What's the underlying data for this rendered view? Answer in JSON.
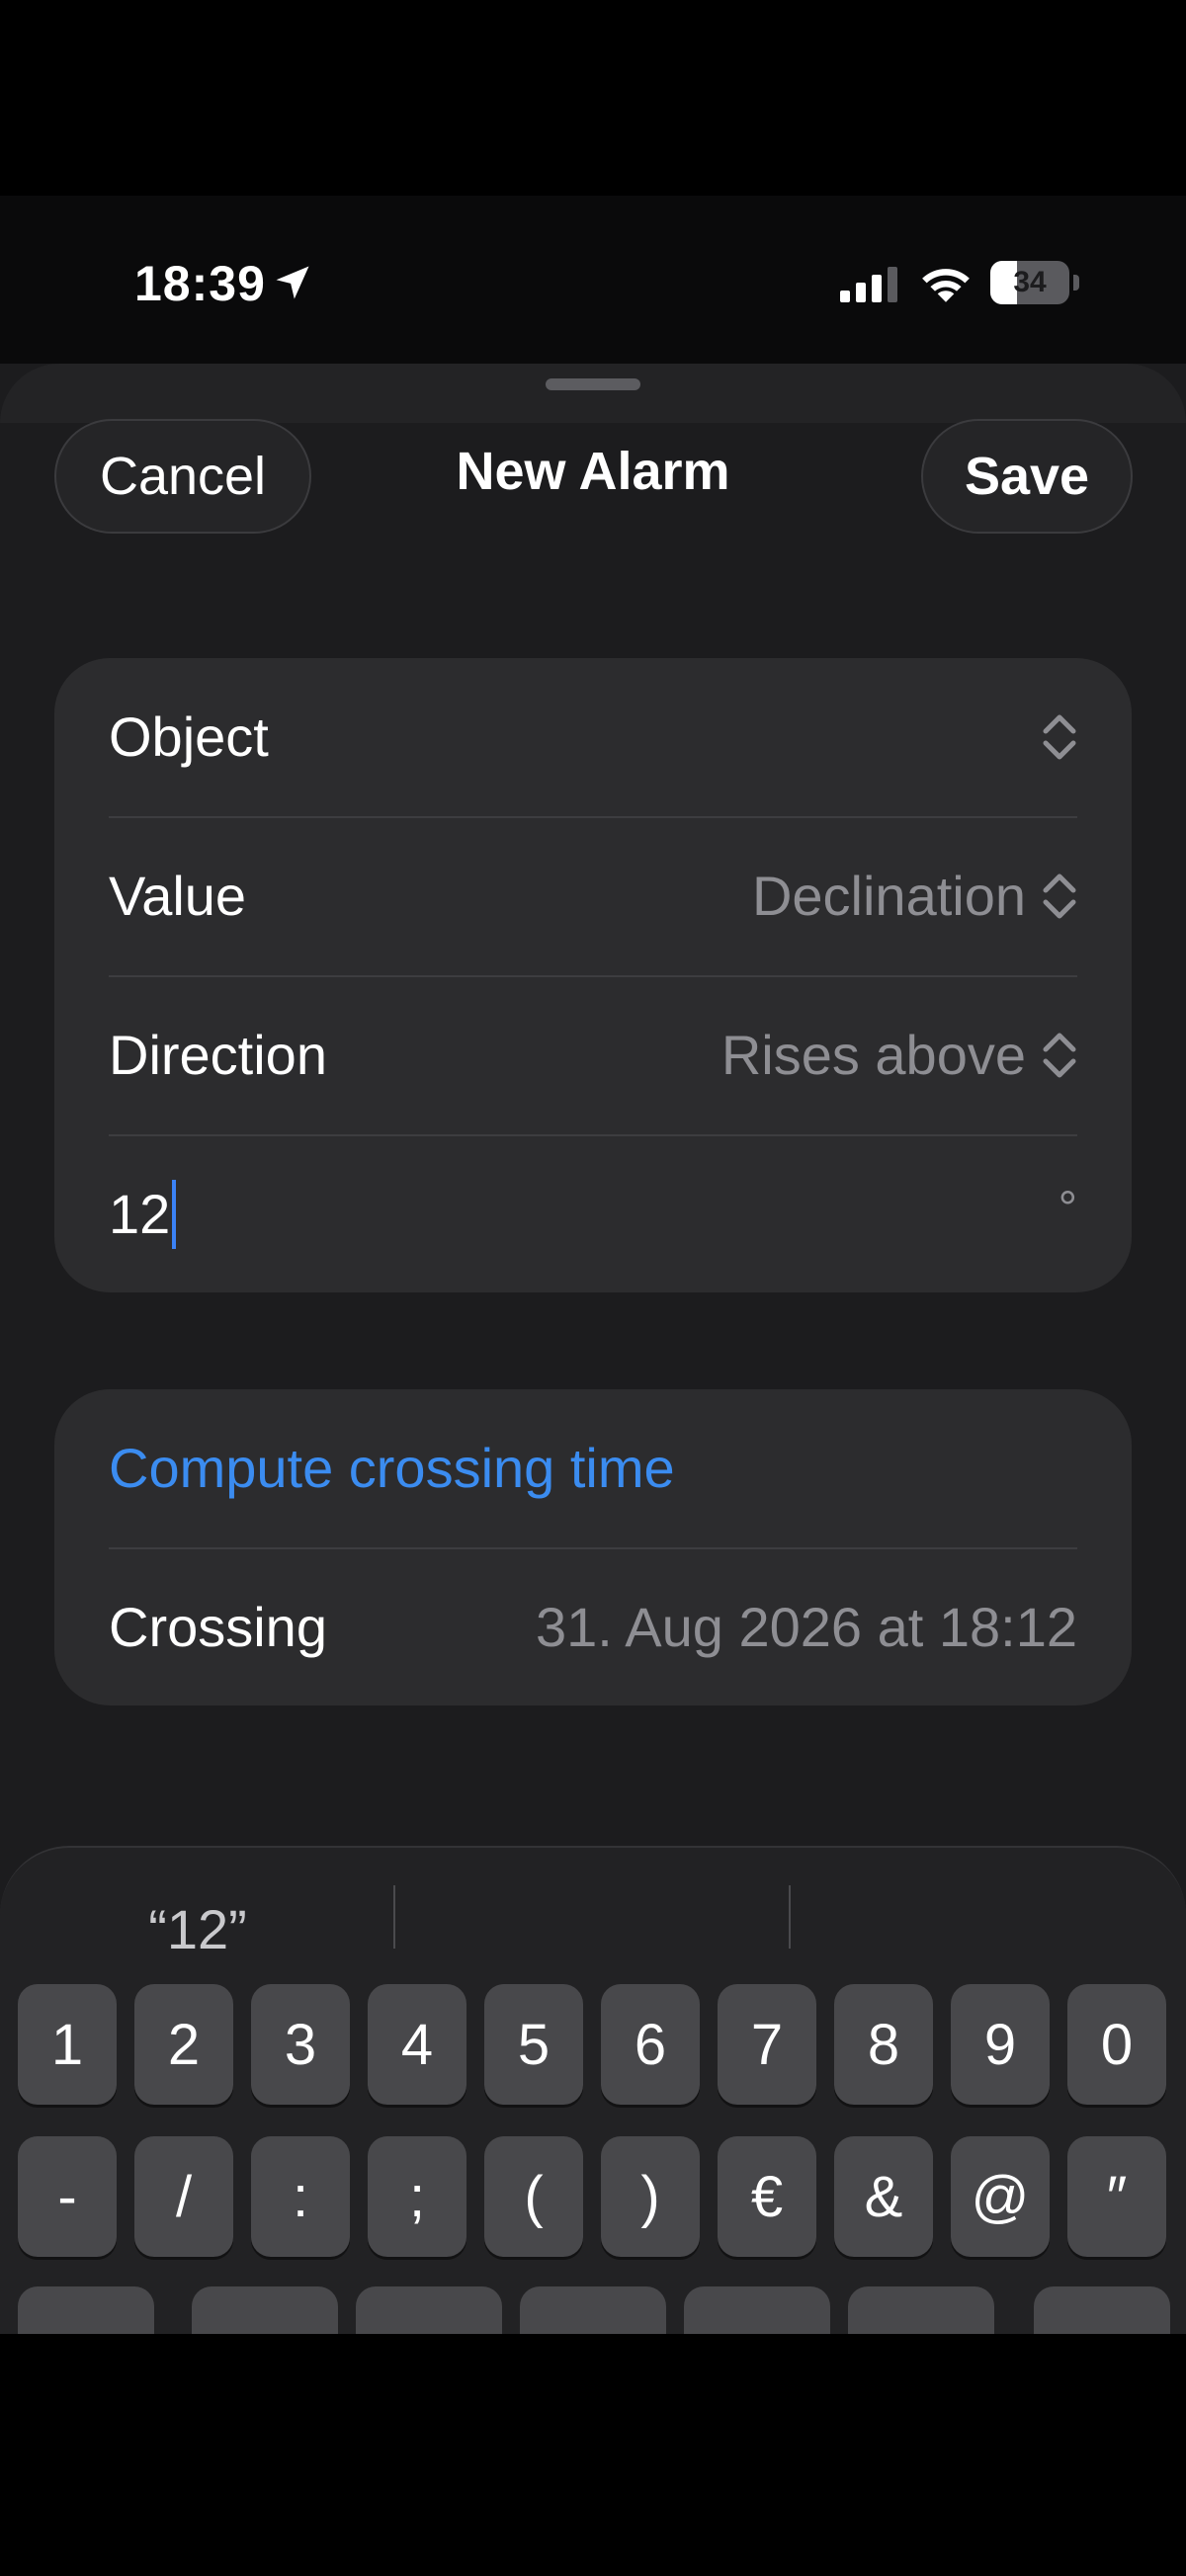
{
  "status_bar": {
    "time": "18:39",
    "battery": "34",
    "battery_level": 0.34,
    "icons": [
      "location-arrow-icon",
      "cellular-signal-icon",
      "wifi-icon",
      "battery-icon"
    ]
  },
  "sheet": {
    "title": "New Alarm",
    "cancel_label": "Cancel",
    "save_label": "Save"
  },
  "form": {
    "object_label": "Object",
    "object_value": "",
    "value_label": "Value",
    "value_value": "Declination",
    "direction_label": "Direction",
    "direction_value": "Rises above",
    "threshold_value": "12",
    "threshold_unit": "°"
  },
  "compute": {
    "link_label": "Compute crossing time",
    "crossing_label": "Crossing",
    "crossing_value": "31. Aug 2026 at 18:12"
  },
  "keyboard": {
    "suggestions": [
      "“12”",
      "",
      ""
    ],
    "row1": [
      "1",
      "2",
      "3",
      "4",
      "5",
      "6",
      "7",
      "8",
      "9",
      "0"
    ],
    "row2": [
      "-",
      "/",
      ":",
      ";",
      "(",
      ")",
      "€",
      "&",
      "@",
      "″"
    ]
  },
  "colors": {
    "accent": "#3b8cf0",
    "background": "#1c1c1e",
    "card": "#2c2c2e",
    "secondary_text": "#8e8e93"
  }
}
